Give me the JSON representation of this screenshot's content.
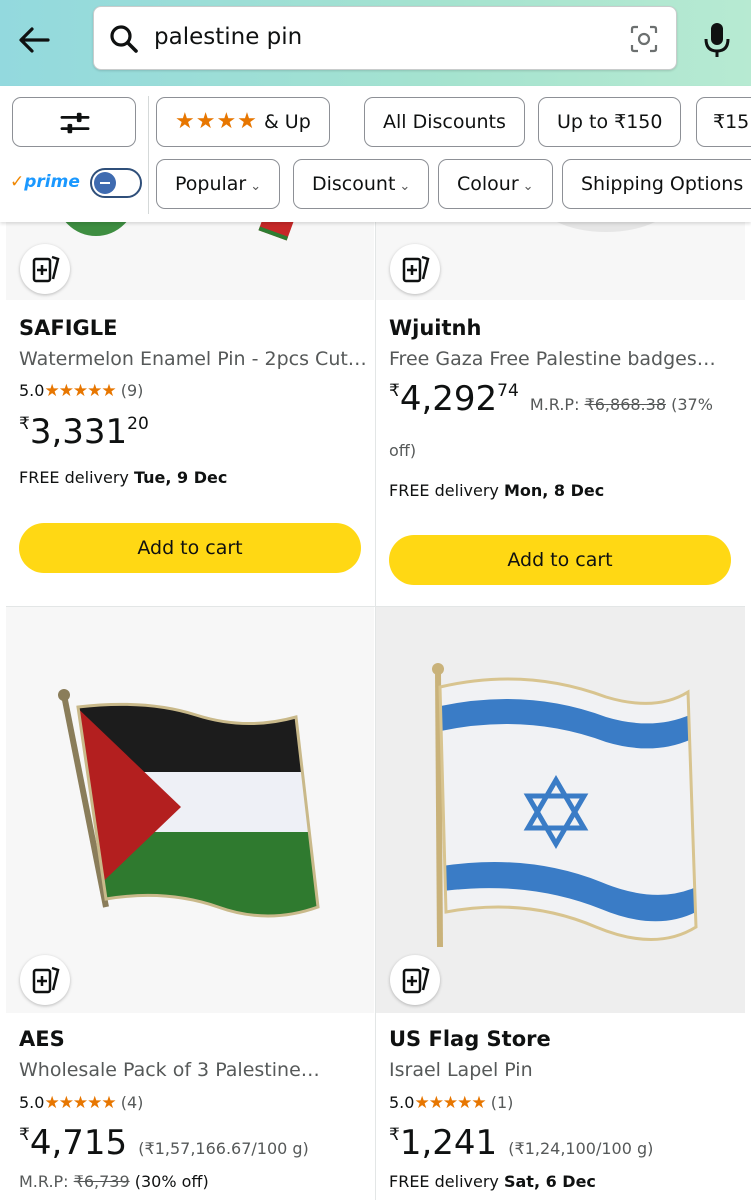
{
  "search": {
    "query": "palestine pin"
  },
  "filters": {
    "prime_label": "prime",
    "prime_check": "✓",
    "chips_row1": [
      {
        "label": "& Up",
        "stars": "★★★★"
      },
      {
        "label": "All Discounts"
      },
      {
        "label": "Up to ₹150"
      },
      {
        "label": "₹15"
      }
    ],
    "chips_row2": [
      {
        "label": "Popular"
      },
      {
        "label": "Discount"
      },
      {
        "label": "Colour"
      },
      {
        "label": "Shipping Options"
      }
    ]
  },
  "products": [
    {
      "brand": "SAFIGLE",
      "title": "Watermelon Enamel Pin - 2pcs Cut…",
      "rating": "5.0",
      "stars": "★★★★★",
      "reviews": "(9)",
      "price_symbol": "₹",
      "price_whole": "3,331",
      "price_fraction": "20",
      "delivery_prefix": "FREE delivery ",
      "delivery_date": "Tue, 9 Dec",
      "cart_label": "Add to cart"
    },
    {
      "brand": "Wjuitnh",
      "title": "Free Gaza Free Palestine badges…",
      "price_symbol": "₹",
      "price_whole": "4,292",
      "price_fraction": "74",
      "mrp_label": "M.R.P:",
      "mrp_value": "₹6,868.38",
      "discount": "(37%",
      "discount_cont": "off)",
      "delivery_prefix": "FREE delivery ",
      "delivery_date": "Mon, 8 Dec",
      "cart_label": "Add to cart"
    },
    {
      "brand": "AES",
      "title": "Wholesale Pack of 3 Palestine…",
      "rating": "5.0",
      "stars": "★★★★★",
      "reviews": "(4)",
      "price_symbol": "₹",
      "price_whole": "4,715",
      "unit_price": "(₹1,57,166.67/100 g)",
      "mrp_label": "M.R.P:",
      "mrp_value": "₹6,739",
      "discount": "(30% off)"
    },
    {
      "brand": "US Flag Store",
      "title": "Israel Lapel Pin",
      "rating": "5.0",
      "stars": "★★★★★",
      "reviews": "(1)",
      "price_symbol": "₹",
      "price_whole": "1,241",
      "unit_price": "(₹1,24,100/100 g)",
      "delivery_prefix": "FREE delivery ",
      "delivery_date": "Sat, 6 Dec"
    }
  ],
  "colors": {
    "header_gradient_start": "#93d9de",
    "header_gradient_end": "#b7ead2",
    "cart_button": "#ffd814",
    "star": "#e77600",
    "prime_blue": "#1a98ff"
  }
}
